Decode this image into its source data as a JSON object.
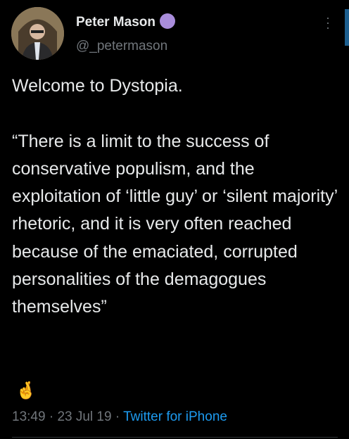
{
  "author": {
    "name": "Peter Mason",
    "handle": "@_petermason"
  },
  "tweet": {
    "text": "Welcome to Dystopia.\n\n“There is a limit to the success of conservative populism, and the exploitation of ‘little guy’ or ‘silent majority’ rhetoric, and it is very often reached because of the emaciated, corrupted personalities of the demagogues themselves”",
    "emoji": "🤞",
    "time": "13:49",
    "date": "23 Jul 19",
    "source": "Twitter for iPhone",
    "sep": " · "
  },
  "colors": {
    "link": "#1d9bf0",
    "badge": "#a98ddb"
  }
}
